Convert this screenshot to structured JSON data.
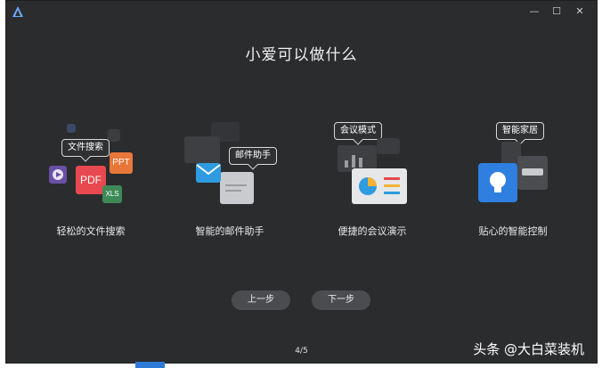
{
  "window": {
    "title": "",
    "controls": {
      "minimize": "—",
      "maximize": "☐",
      "close": "✕"
    }
  },
  "page": {
    "title": "小爱可以做什么",
    "indicator": "4/5"
  },
  "features": [
    {
      "label": "轻松的文件搜索",
      "bubble": "文件搜索",
      "tiles": {
        "pdf": "PDF",
        "ppt": "PPT",
        "xls": "XLS"
      }
    },
    {
      "label": "智能的邮件助手",
      "bubble": "邮件助手"
    },
    {
      "label": "便捷的会议演示",
      "bubble": "会议模式"
    },
    {
      "label": "贴心的智能控制",
      "bubble": "智能家居"
    }
  ],
  "buttons": {
    "prev": "上一步",
    "next": "下一步"
  },
  "watermark": "头条 @大白菜装机",
  "colors": {
    "background": "#2b2c2e",
    "pdf": "#e8484f",
    "ppt": "#e8773a",
    "xls": "#3d8a58",
    "bulb": "#2f7fe0"
  }
}
